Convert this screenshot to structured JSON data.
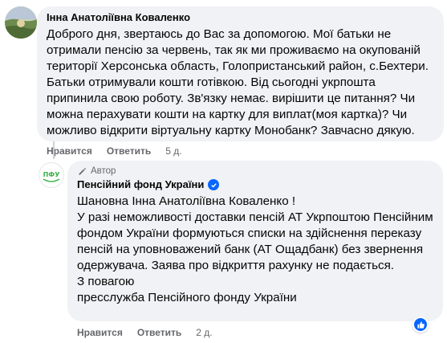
{
  "comment": {
    "author": "Інна Анатоліївна Коваленко",
    "text": "Доброго дня, звертаюсь до Вас за допомогою. Мої батьки не отримали пенсію за червень, так як ми проживаємо на окупованій території Херсонська область, Голопристанський район, с.Бехтери. Батьки отримували кошти готівкою. Від сьогодні укрпошта припинила свою роботу. Зв'язку немає. вирішити це питання? Чи можна перахувати кошти на картку для виплат(моя картка)? Чи можливо відкрити віртуальну картку Монобанк? Завчасно дякую.",
    "like_label": "Нравится",
    "reply_label": "Ответить",
    "time": "5 д."
  },
  "reply": {
    "badge_label": "Автор",
    "author": "Пенсійний фонд України",
    "greeting_prefix": "Шановна ",
    "greeting_name": "Інна Анатоліївна Коваленко",
    "greeting_suffix": " !",
    "text": "У разі неможливості доставки пенсій АТ Укрпоштою Пенсійним фондом України формуються списки на здійснення переказу пенсій на уповноважений банк (АТ Ощадбанк) без звернення одержувача. Заява про відкриття рахунку не подається.",
    "signoff_1": "З повагою",
    "signoff_2": "пресслужба Пенсійного фонду України",
    "like_label": "Нравится",
    "reply_label": "Ответить",
    "time": "2 д.",
    "avatar_text": "ПФУ"
  },
  "colors": {
    "bubble": "#f0f2f5",
    "meta": "#65676b",
    "accent": "#0866ff",
    "pfu_green": "#3bb34a"
  }
}
